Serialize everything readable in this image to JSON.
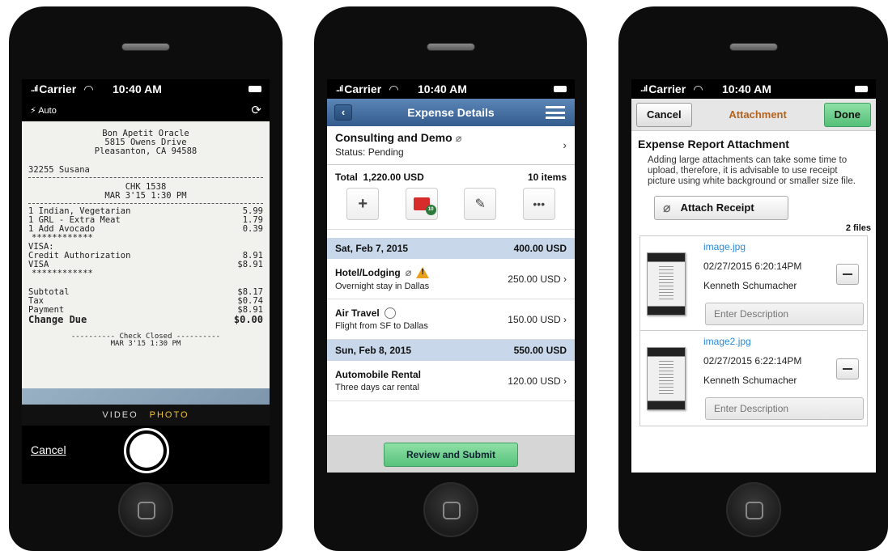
{
  "status_bar": {
    "carrier": "Carrier",
    "time": "10:40 AM",
    "signal": "..ıl"
  },
  "camera": {
    "flash_label": "Auto",
    "modes": [
      "VIDEO",
      "PHOTO"
    ],
    "active_mode": "PHOTO",
    "cancel_label": "Cancel",
    "receipt": {
      "header": [
        "Bon Apetit Oracle",
        "5815 Owens Drive",
        "Pleasanton, CA 94588"
      ],
      "server": "32255 Susana",
      "check": [
        "CHK 1538",
        "MAR 3'15 1:30 PM"
      ],
      "items": [
        {
          "name": "1 Indian, Vegetarian",
          "amount": "5.99"
        },
        {
          "name": "1 GRL - Extra Meat",
          "amount": "1.79"
        },
        {
          "name": "1 Add Avocado",
          "amount": "0.39"
        }
      ],
      "stars": "************",
      "visa_label": "VISA:",
      "credit_auth": {
        "name": "Credit Authorization",
        "amount": "8.91"
      },
      "visa": {
        "name": "VISA",
        "amount": "$8.91"
      },
      "subtotal": {
        "name": "Subtotal",
        "amount": "$8.17"
      },
      "tax": {
        "name": "Tax",
        "amount": "$0.74"
      },
      "payment": {
        "name": "Payment",
        "amount": "$8.91"
      },
      "change": {
        "name": "Change Due",
        "amount": "$0.00"
      },
      "closed": "---------- Check Closed ----------",
      "closed_time": "MAR 3'15 1:30 PM"
    }
  },
  "expense": {
    "nav_title": "Expense Details",
    "report_title": "Consulting and Demo",
    "report_status": "Status: Pending",
    "total_label": "Total",
    "total_value": "1,220.00 USD",
    "items_count": "10 items",
    "wallet_badge": "10",
    "days": [
      {
        "date": "Sat, Feb 7, 2015",
        "total": "400.00 USD",
        "expenses": [
          {
            "name": "Hotel/Lodging",
            "desc": "Overnight stay in Dallas",
            "amount": "250.00 USD"
          },
          {
            "name": "Air Travel",
            "desc": "Flight from SF to Dallas",
            "amount": "150.00 USD"
          }
        ]
      },
      {
        "date": "Sun, Feb 8, 2015",
        "total": "550.00 USD",
        "expenses": [
          {
            "name": "Automobile Rental",
            "desc": "Three days car rental",
            "amount": "120.00 USD"
          }
        ]
      }
    ],
    "review_label": "Review and Submit"
  },
  "attachment": {
    "cancel_label": "Cancel",
    "nav_title": "Attachment",
    "done_label": "Done",
    "heading": "Expense Report Attachment",
    "info": "Adding large attachments can take some time to upload, therefore, it is advisable to use receipt picture using white background or smaller size file.",
    "attach_label": "Attach Receipt",
    "files_count": "2 files",
    "files": [
      {
        "name": "image.jpg",
        "date": "02/27/2015  6:20:14PM",
        "user": "Kenneth Schumacher",
        "desc_placeholder": "Enter Description"
      },
      {
        "name": "image2.jpg",
        "date": "02/27/2015  6:22:14PM",
        "user": "Kenneth Schumacher",
        "desc_placeholder": "Enter Description"
      }
    ]
  }
}
